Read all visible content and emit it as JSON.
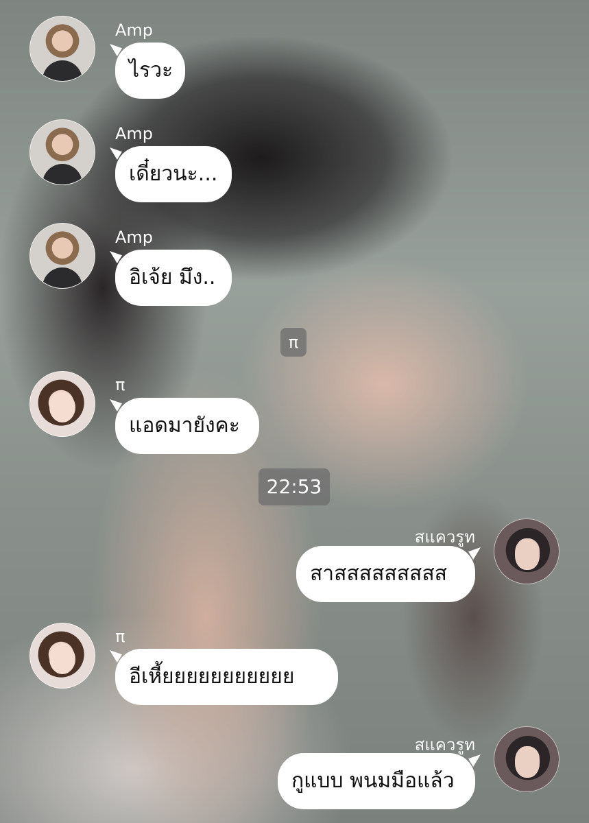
{
  "messages": [
    {
      "sender": "Amp",
      "text": "ไรวะ"
    },
    {
      "sender": "Amp",
      "text": "เดี๋ยวนะ..."
    },
    {
      "sender": "Amp",
      "text": "อิเจ้ย มึง.."
    },
    {
      "sender": "π",
      "text": "แอดมายังคะ"
    },
    {
      "sender": "สแควรูท",
      "text": "สาสสสสสสสสส"
    },
    {
      "sender": "π",
      "text": "อีเหี้ยยยยยยยยยยย"
    },
    {
      "sender": "สแควรูท",
      "text": "กูแบบ พนมมือแล้ว"
    }
  ],
  "system": {
    "label_pi": "π",
    "time": "22:53"
  }
}
